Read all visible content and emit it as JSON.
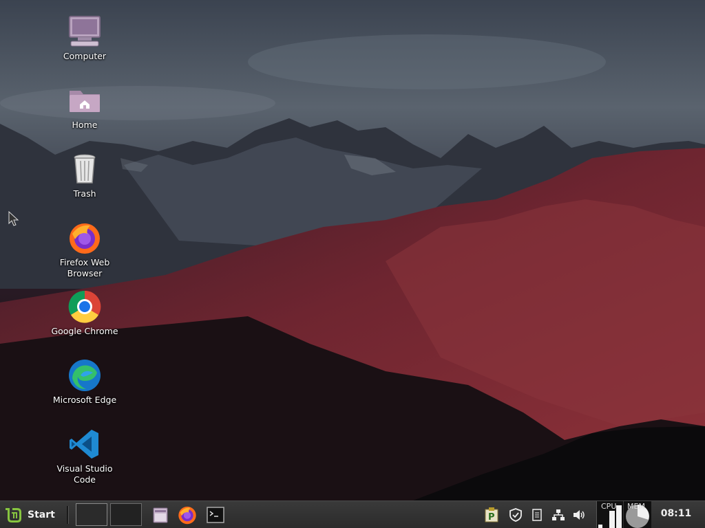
{
  "desktop": {
    "icons": [
      {
        "label": "Computer",
        "icon": "computer-icon"
      },
      {
        "label": "Home",
        "icon": "home-folder-icon"
      },
      {
        "label": "Trash",
        "icon": "trash-icon"
      },
      {
        "label": "Firefox Web Browser",
        "icon": "firefox-icon"
      },
      {
        "label": "Google Chrome",
        "icon": "chrome-icon"
      },
      {
        "label": "Microsoft Edge",
        "icon": "edge-icon"
      },
      {
        "label": "Visual Studio Code",
        "icon": "vscode-icon"
      }
    ]
  },
  "taskbar": {
    "start_label": "Start",
    "launchers": [
      "file-manager-icon",
      "firefox-icon",
      "terminal-icon"
    ],
    "tray": [
      "parcellite-icon",
      "shield-icon",
      "notes-icon",
      "network-icon",
      "volume-icon"
    ],
    "cpu_label": "CPU",
    "mem_label": "MEM",
    "clock": "08:11"
  },
  "colors": {
    "taskbar_bg": "#2b2b2b",
    "mint_green": "#87c540",
    "vscode_blue": "#1f8ad2"
  }
}
